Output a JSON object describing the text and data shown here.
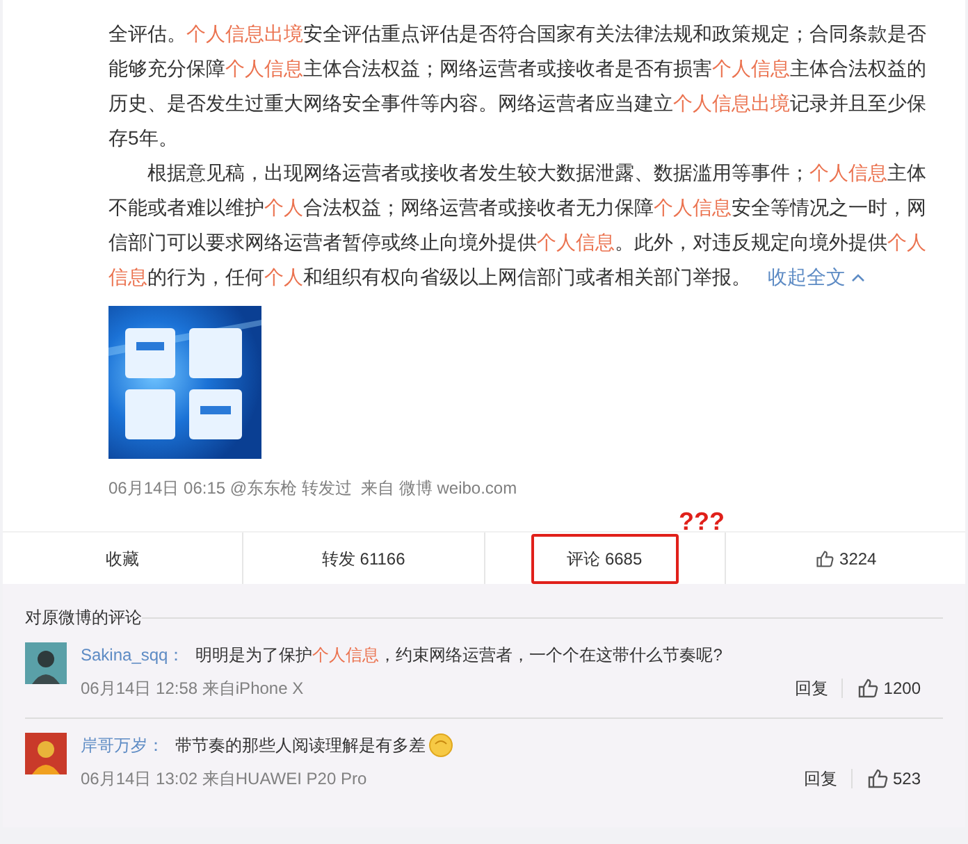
{
  "post": {
    "paragraphs": [
      {
        "indent": false,
        "segments": [
          {
            "kind": "plain",
            "text": "全评估。"
          },
          {
            "kind": "keyword",
            "text": "个人信息出境"
          },
          {
            "kind": "plain",
            "text": "安全评估重点评估是否符合国家有关法律法规和政策规定；合同条款是否能够充分保障"
          },
          {
            "kind": "keyword",
            "text": "个人信息"
          },
          {
            "kind": "plain",
            "text": "主体合法权益；网络运营者或接收者是否有损害"
          },
          {
            "kind": "keyword",
            "text": "个人信息"
          },
          {
            "kind": "plain",
            "text": "主体合法权益的历史、是否发生过重大网络安全事件等内容。网络运营者应当建立"
          },
          {
            "kind": "keyword",
            "text": "个人信息出境"
          },
          {
            "kind": "plain",
            "text": "记录并且至少保存5年。"
          }
        ]
      },
      {
        "indent": true,
        "segments": [
          {
            "kind": "plain",
            "text": "根据意见稿，出现网络运营者或接收者发生较大数据泄露、数据滥用等事件；"
          },
          {
            "kind": "keyword",
            "text": "个人信息"
          },
          {
            "kind": "plain",
            "text": "主体不能或者难以维护"
          },
          {
            "kind": "keyword",
            "text": "个人"
          },
          {
            "kind": "plain",
            "text": "合法权益；网络运营者或接收者无力保障"
          },
          {
            "kind": "keyword",
            "text": "个人信息"
          },
          {
            "kind": "plain",
            "text": "安全等情况之一时，网信部门可以要求网络运营者暂停或终止向境外提供"
          },
          {
            "kind": "keyword",
            "text": "个人信息"
          },
          {
            "kind": "plain",
            "text": "。此外，对违反规定向境外提供"
          },
          {
            "kind": "keyword",
            "text": "个人信息"
          },
          {
            "kind": "plain",
            "text": "的行为，任何"
          },
          {
            "kind": "keyword",
            "text": "个人"
          },
          {
            "kind": "plain",
            "text": "和组织有权向省级以上网信部门或者相关部门举报。"
          }
        ]
      }
    ],
    "collapse_link": "收起全文",
    "meta": "06月14日 06:15 @东东枪 转发过  来自 微博 weibo.com"
  },
  "annotation": "???",
  "actions": [
    {
      "kind": "text",
      "label": "收藏",
      "highlighted": false
    },
    {
      "kind": "text",
      "label": "转发 61166",
      "highlighted": false
    },
    {
      "kind": "text",
      "label": "评论 6685",
      "highlighted": true
    },
    {
      "kind": "like",
      "label": "3224",
      "highlighted": false
    }
  ],
  "comments": {
    "title": "对原微博的评论",
    "items": [
      {
        "user": "Sakina_sqq",
        "separator": "：",
        "segments": [
          {
            "kind": "plain",
            "text": "明明是为了保护"
          },
          {
            "kind": "keyword",
            "text": "个人信息"
          },
          {
            "kind": "plain",
            "text": "，约束网络运营者，一个个在这带什么节奏呢?"
          }
        ],
        "emoji": false,
        "time": "06月14日 12:58 来自iPhone X",
        "reply": "回复",
        "likes": "1200"
      },
      {
        "user": "岸哥万岁",
        "separator": "：",
        "segments": [
          {
            "kind": "plain",
            "text": "带节奏的那些人阅读理解是有多差"
          }
        ],
        "emoji": true,
        "time": "06月14日 13:02 来自HUAWEI P20 Pro",
        "reply": "回复",
        "likes": "523"
      }
    ]
  }
}
